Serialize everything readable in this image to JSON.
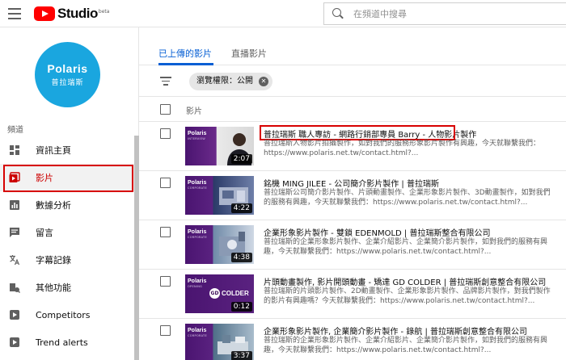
{
  "header": {
    "logo_text": "Studio",
    "logo_badge": "beta",
    "search_placeholder": "在頻道中搜尋"
  },
  "sidebar": {
    "channel": {
      "name": "Polaris",
      "subtitle": "普拉瑞斯"
    },
    "section_label": "頻道",
    "items": [
      {
        "label": "資訊主頁",
        "icon": "dashboard-icon"
      },
      {
        "label": "影片",
        "icon": "video-icon",
        "active": true
      },
      {
        "label": "數據分析",
        "icon": "analytics-icon"
      },
      {
        "label": "留言",
        "icon": "comments-icon"
      },
      {
        "label": "字幕記錄",
        "icon": "translate-icon"
      },
      {
        "label": "其他功能",
        "icon": "other-features-icon"
      },
      {
        "label": "Competitors",
        "icon": "competitors-icon"
      },
      {
        "label": "Trend alerts",
        "icon": "trend-alerts-icon"
      }
    ]
  },
  "tabs": [
    {
      "label": "已上傳的影片",
      "active": true
    },
    {
      "label": "直播影片",
      "active": false
    }
  ],
  "filter": {
    "chip_label": "瀏覽權限：公開"
  },
  "list": {
    "column_label": "影片",
    "videos": [
      {
        "title": "普拉瑞斯 職人專訪 - 網路行銷部專員 Barry - 人物影片製作",
        "desc": "普拉瑞斯人物影片拍攝製作，如對我們的服務形象影片製作有興趣，今天就聯繫我們：https://www.polaris.net.tw/contact.html?...",
        "duration": "2:07",
        "thumb_brand": "Polaris",
        "thumb_sub": "INTERVIEW"
      },
      {
        "title": "銘機 MING JILEE - 公司簡介影片製作 | 普拉瑞斯",
        "desc": "普拉瑞斯公司簡介影片製作、片頭動畫製作、企業形象影片製作、3D動畫製作，如對我們的服務有興趣，今天就聯繫我們：https://www.polaris.net.tw/contact.html?...",
        "duration": "4:22",
        "thumb_brand": "Polaris",
        "thumb_sub": "CORPORATE"
      },
      {
        "title": "企業形象影片製作 - 雙鎖 EDENMOLD | 普拉瑞斯整合有限公司",
        "desc": "普拉瑞斯的企業形象影片製作、企業介紹影片、企業簡介影片製作，如對我們的服務有興趣，今天就聯繫我們：https://www.polaris.net.tw/contact.html?...",
        "duration": "4:38",
        "thumb_brand": "Polaris",
        "thumb_sub": "CORPORATE"
      },
      {
        "title": "片頭動畫製作, 影片開頭動畫 - 矯達 GD COLDER | 普拉瑞斯創意整合有限公司",
        "desc": "普拉瑞斯的片頭影片製作、2D動畫製作、企業形象影片製作、品牌影片製作，對我們製作的影片有興趣嗎？今天就聯繫我們：https://www.polaris.net.tw/contact.html?...",
        "duration": "0:12",
        "thumb_brand": "Polaris",
        "thumb_sub": "OPENING",
        "thumb_logo": "COLDER",
        "thumb_logo_mark": "GD"
      },
      {
        "title": "企業形象影片製作, 企業簡介影片製作 - 錄航 | 普拉瑞斯創意整合有限公司",
        "desc": "普拉瑞斯的企業形象影片製作、企業介紹影片、企業簡介影片製作，如對我們的服務有興趣，今天就聯繫我們：https://www.polaris.net.tw/contact.html?...",
        "duration": "3:37",
        "thumb_brand": "Polaris",
        "thumb_sub": "CORPORATE"
      }
    ]
  },
  "colors": {
    "accent": "#065fd4",
    "brand_red": "#ff0000",
    "highlight": "#d70000",
    "avatar_bg": "#1aa6df"
  }
}
